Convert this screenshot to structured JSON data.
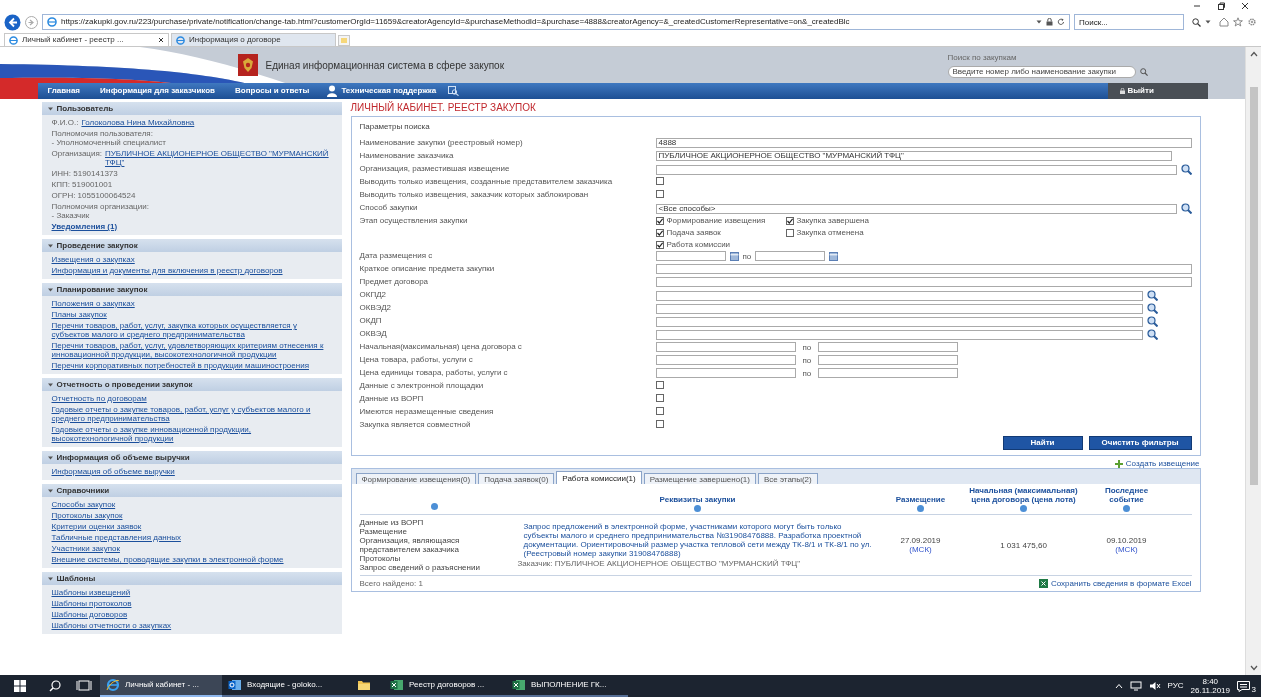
{
  "browser": {
    "url": "https://zakupki.gov.ru/223/purchase/private/notification/change-tab.html?customerOrgId=11659&creatorAgencyId=&purchaseMethodId=&purchase=4888&creatorAgency=&_createdCustomerRepresentative=on&_createdBlc",
    "search": {
      "placeholder": "Поиск..."
    },
    "tabs": [
      {
        "label": "Личный кабинет - реестр ...",
        "selected": true
      },
      {
        "label": "Информация о договоре",
        "selected": false
      }
    ]
  },
  "site": {
    "title": "Единая информационная система в сфере закупок",
    "search_label": "Поиск по закупкам",
    "search": {
      "placeholder": "Введите номер либо наименование закупки"
    },
    "nav": [
      {
        "kind": "link",
        "label": "Главная"
      },
      {
        "kind": "link",
        "label": "Информация для заказчиков"
      },
      {
        "kind": "link",
        "label": "Вопросы и ответы"
      },
      {
        "kind": "support",
        "label": "Техническая поддержка"
      },
      {
        "kind": "icon"
      },
      {
        "kind": "exit",
        "label": "Выйти"
      }
    ]
  },
  "sidebar": [
    {
      "title": "Пользователь",
      "items": [
        {
          "kind": "inline",
          "label": "Ф.И.О.:",
          "value": "Голоколова Нина Михайловна"
        },
        {
          "kind": "stacked",
          "label": "Полномочия пользователя:",
          "value": "- Уполномоченный специалист"
        },
        {
          "kind": "inline",
          "label": "Организация:",
          "value": "ПУБЛИЧНОЕ АКЦИОНЕРНОЕ ОБЩЕСТВО \"МУРМАНСКИЙ ТФЦ\""
        },
        {
          "kind": "text",
          "label": "ИНН: 5190141373"
        },
        {
          "kind": "text",
          "label": "КПП: 519001001"
        },
        {
          "kind": "text",
          "label": "ОГРН: 1055100064524"
        },
        {
          "kind": "stacked",
          "label": "Полномочия организации:",
          "value": "- Заказчик"
        },
        {
          "kind": "strong_link",
          "label": "Уведомления (1)"
        }
      ]
    },
    {
      "title": "Проведение закупок",
      "items": [
        {
          "kind": "link",
          "label": "Извещения о закупках"
        },
        {
          "kind": "link",
          "label": "Информация и документы для включения в реестр договоров"
        }
      ]
    },
    {
      "title": "Планирование закупок",
      "items": [
        {
          "kind": "link",
          "label": "Положения о закупках"
        },
        {
          "kind": "link",
          "label": "Планы закупок"
        },
        {
          "kind": "link",
          "label": "Перечни товаров, работ, услуг, закупка которых осуществляется у субъектов малого и среднего предпринимательства"
        },
        {
          "kind": "link",
          "label": "Перечни товаров, работ, услуг, удовлетворяющих критериям отнесения к инновационной продукции, высокотехнологичной продукции"
        },
        {
          "kind": "link",
          "label": "Перечни корпоративных потребностей в продукции машиностроения"
        }
      ]
    },
    {
      "title": "Отчетность о проведении закупок",
      "items": [
        {
          "kind": "link",
          "label": "Отчетность по договорам"
        },
        {
          "kind": "link",
          "label": "Годовые отчеты о закупке товаров, работ, услуг у субъектов малого и среднего предпринимательства"
        },
        {
          "kind": "link",
          "label": "Годовые отчеты о закупке инновационной продукции, высокотехнологичной продукции"
        }
      ]
    },
    {
      "title": "Информация об объеме выручки",
      "items": [
        {
          "kind": "link",
          "label": "Информация об объеме выручки"
        }
      ]
    },
    {
      "title": "Справочники",
      "items": [
        {
          "kind": "link",
          "label": "Способы закупок"
        },
        {
          "kind": "link",
          "label": "Протоколы закупок"
        },
        {
          "kind": "link",
          "label": "Критерии оценки заявок"
        },
        {
          "kind": "link",
          "label": "Табличные представления данных"
        },
        {
          "kind": "link",
          "label": "Участники закупок"
        },
        {
          "kind": "link",
          "label": "Внешние системы, проводящие закупки в электронной форме"
        }
      ]
    },
    {
      "title": "Шаблоны",
      "items": [
        {
          "kind": "link",
          "label": "Шаблоны извещений"
        },
        {
          "kind": "link",
          "label": "Шаблоны протоколов"
        },
        {
          "kind": "link",
          "label": "Шаблоны договоров"
        },
        {
          "kind": "link",
          "label": "Шаблоны отчетности о закупках"
        }
      ]
    }
  ],
  "page_title": "ЛИЧНЫЙ КАБИНЕТ. РЕЕСТР ЗАКУПОК",
  "filter": {
    "title": "Параметры поиска",
    "fields": [
      {
        "kind": "text",
        "label": "Наименование закупки (реестровый номер)",
        "value": "4888"
      },
      {
        "kind": "readonly",
        "label": "Наименование заказчика",
        "value": "ПУБЛИЧНОЕ АКЦИОНЕРНОЕ ОБЩЕСТВО \"МУРМАНСКИЙ ТФЦ\""
      },
      {
        "kind": "lookup_readonly",
        "label": "Организация, разместившая извещение"
      },
      {
        "kind": "checkbox",
        "label": "Выводить только извещения, созданные представителем заказчика",
        "checked": false
      },
      {
        "kind": "checkbox",
        "label": "Выводить только извещения, заказчик которых заблокирован",
        "checked": false
      },
      {
        "kind": "lookup",
        "label": "Способ закупки",
        "value": "<Все способы>"
      },
      {
        "kind": "checkgroup",
        "label": "Этап осуществления закупки",
        "options": [
          {
            "label": "Формирование извещения",
            "checked": true
          },
          {
            "label": "Закупка завершена",
            "checked": true
          },
          {
            "label": "Подача заявок",
            "checked": true
          },
          {
            "label": "Закупка отменена",
            "checked": false
          },
          {
            "label": "Работа комиссии",
            "checked": true
          }
        ]
      },
      {
        "kind": "daterange",
        "label": "Дата размещения с",
        "separator": "по"
      },
      {
        "kind": "text",
        "label": "Краткое описание предмета закупки"
      },
      {
        "kind": "text",
        "label": "Предмет договора"
      },
      {
        "kind": "lookup_short",
        "label": "ОКПД2"
      },
      {
        "kind": "lookup_short",
        "label": "ОКВЭД2"
      },
      {
        "kind": "lookup_short",
        "label": "ОКДП"
      },
      {
        "kind": "lookup_short",
        "label": "ОКВЭД"
      },
      {
        "kind": "range",
        "label": "Начальная(максимальная) цена договора с",
        "separator": "по"
      },
      {
        "kind": "range",
        "label": "Цена товара, работы, услуги с",
        "separator": "по"
      },
      {
        "kind": "range",
        "label": "Цена единицы товара, работы, услуги с",
        "separator": "по"
      },
      {
        "kind": "checkbox",
        "label": "Данные с электронной площадки",
        "checked": false
      },
      {
        "kind": "checkbox",
        "label": "Данные из ВОРП",
        "checked": false
      },
      {
        "kind": "checkbox",
        "label": "Имеются неразмещенные сведения",
        "checked": false
      },
      {
        "kind": "checkbox",
        "label": "Закупка является совместной",
        "checked": false
      }
    ],
    "buttons": [
      "Найти",
      "Очистить фильтры"
    ]
  },
  "create_link": "Создать извещение",
  "result_tabs": [
    {
      "label": "Формирование извещения(0)",
      "selected": false
    },
    {
      "label": "Подача заявок(0)",
      "selected": false
    },
    {
      "label": "Работа комиссии(1)",
      "selected": true
    },
    {
      "label": "Размещение завершено(1)",
      "selected": false
    },
    {
      "label": "Все этапы(2)",
      "selected": false
    }
  ],
  "table": {
    "columns": [
      "Реквизиты закупки",
      "Размещение",
      "Начальная (максимальная) цена договора (цена лота)",
      "Последнее событие"
    ],
    "rows": [
      {
        "info": [
          "Данные из ВОРП",
          "Размещение",
          "Организация, являющаяся представителем заказчика",
          "Протоколы",
          "Запрос сведений о разъяснении"
        ],
        "title": "Запрос предложений в электронной форме, участниками которого могут быть только субъекты малого и среднего предпринимательства №31908476888. Разработка проектной документации. Ориентировочный размер участка тепловой сети между ТК-8/1 и ТК-8/1 по ул. (Реестровый номер закупки 31908476888)",
        "customer": "Заказчик: ПУБЛИЧНОЕ АКЦИОНЕРНОЕ ОБЩЕСТВО \"МУРМАНСКИЙ ТФЦ\"",
        "published": "27.09.2019",
        "published_tz": "(МСК)",
        "price": "1 031 475,60",
        "event": "09.10.2019",
        "event_tz": "(МСК)"
      }
    ]
  },
  "total": "Всего найдено: 1",
  "export_link": "Сохранить сведения в формате Excel",
  "taskbar": {
    "apps": [
      {
        "kind": "browser",
        "label": "Личный кабинет - ...",
        "selected": true
      },
      {
        "kind": "mail",
        "label": "Входящие - goloko...",
        "selected": false
      },
      {
        "kind": "folder",
        "selected": false
      },
      {
        "kind": "spreadsheet",
        "label": "Реестр договоров ...",
        "selected": false
      },
      {
        "kind": "spreadsheet",
        "label": "ВЫПОЛНЕНИЕ ГК...",
        "selected": false
      }
    ],
    "language": "РУС",
    "time": "8:40",
    "date": "26.11.2019",
    "notifications": "3"
  }
}
